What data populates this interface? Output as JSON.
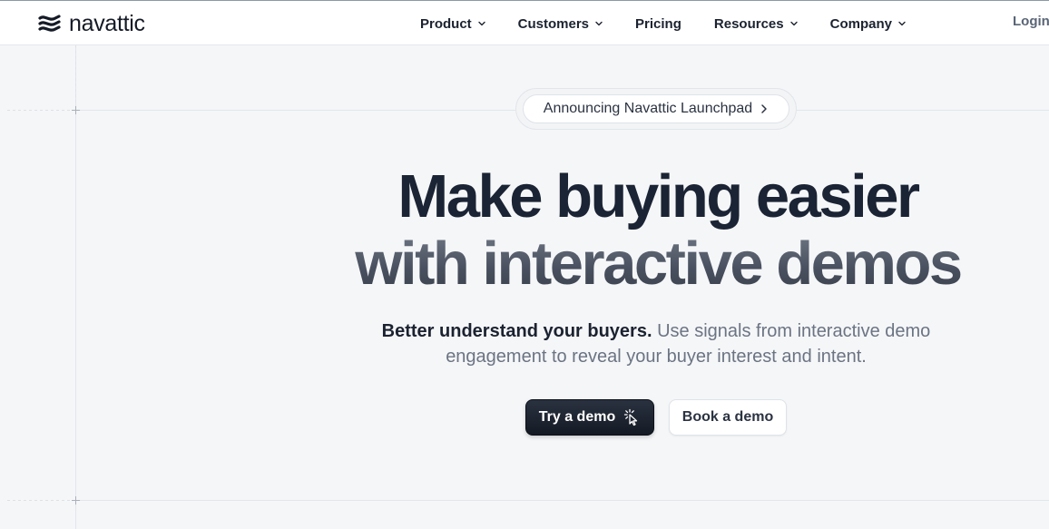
{
  "brand": {
    "name": "navattic",
    "logo_icon": "navattic-flag-icon"
  },
  "nav": {
    "items": [
      {
        "label": "Product",
        "has_dropdown": true
      },
      {
        "label": "Customers",
        "has_dropdown": true
      },
      {
        "label": "Pricing",
        "has_dropdown": false
      },
      {
        "label": "Resources",
        "has_dropdown": true
      },
      {
        "label": "Company",
        "has_dropdown": true
      }
    ],
    "login_label": "Login"
  },
  "hero": {
    "announcement": "Announcing Navattic Launchpad",
    "headline_line1": "Make buying easier",
    "headline_line2": "with interactive demos",
    "subtitle_strong": "Better understand your buyers.",
    "subtitle_rest": " Use signals from interactive demo engagement to reveal your buyer interest and intent.",
    "primary_cta": "Try a demo",
    "primary_cta_icon": "cursor-click-icon",
    "secondary_cta": "Book a demo"
  },
  "colors": {
    "background": "#f5f6f8",
    "header_background": "#ffffff",
    "primary_button": "#1b2230",
    "text_dark": "#1b2230",
    "text_muted": "#6b7483"
  }
}
